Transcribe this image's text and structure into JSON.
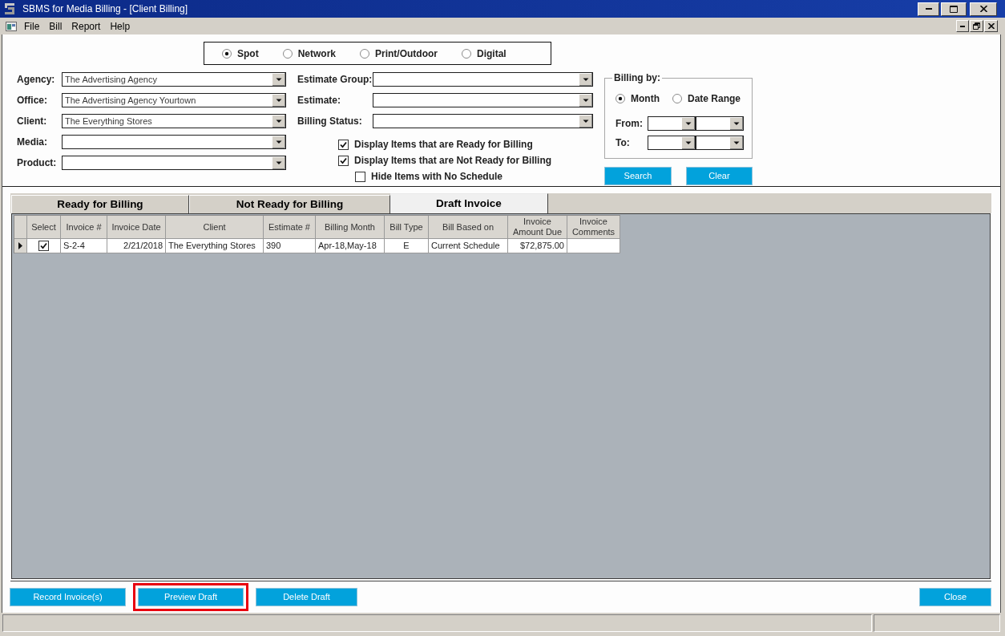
{
  "window": {
    "title": "SBMS for Media Billing - [Client Billing]"
  },
  "menu": [
    "File",
    "Bill",
    "Report",
    "Help"
  ],
  "media_type": [
    {
      "label": "Spot",
      "selected": true
    },
    {
      "label": "Network",
      "selected": false
    },
    {
      "label": "Print/Outdoor",
      "selected": false
    },
    {
      "label": "Digital",
      "selected": false
    }
  ],
  "filters_left": [
    {
      "label": "Agency:",
      "value": "The Advertising Agency"
    },
    {
      "label": "Office:",
      "value": "The Advertising Agency Yourtown"
    },
    {
      "label": "Client:",
      "value": "The Everything Stores"
    },
    {
      "label": "Media:"
    },
    {
      "label": "Product:"
    }
  ],
  "filters_right": [
    {
      "label": "Estimate Group:"
    },
    {
      "label": "Estimate:"
    },
    {
      "label": "Billing Status:"
    }
  ],
  "display_options": [
    {
      "label": "Display Items that are Ready for Billing",
      "checked": true
    },
    {
      "label": "Display Items that are Not Ready for Billing",
      "checked": true,
      "children": [
        {
          "label": "Hide Items with No Schedule",
          "checked": false
        }
      ]
    }
  ],
  "billing_by": {
    "title": "Billing by:",
    "modes": [
      {
        "label": "Month",
        "selected": true
      },
      {
        "label": "Date Range",
        "selected": false
      }
    ],
    "range_fields": [
      {
        "label": "From:"
      },
      {
        "label": "To:"
      }
    ]
  },
  "search_actions": [
    "Search",
    "Clear"
  ],
  "tabs": [
    {
      "label": "Ready for Billing",
      "selected": false
    },
    {
      "label": "Not Ready for Billing",
      "selected": false
    },
    {
      "label": "Draft Invoice",
      "selected": true
    }
  ],
  "table": {
    "columns": [
      {
        "label": "Select",
        "kind": "check"
      },
      {
        "label": "Invoice #",
        "kind": "text"
      },
      {
        "label": "Invoice Date",
        "kind": "number"
      },
      {
        "label": "Client",
        "kind": "text"
      },
      {
        "label": "Estimate #",
        "kind": "text"
      },
      {
        "label": "Billing Month",
        "kind": "text"
      },
      {
        "label": "Bill Type",
        "kind": "code"
      },
      {
        "label": "Bill Based on",
        "kind": "text"
      },
      {
        "label": "Invoice Amount Due",
        "kind": "number"
      },
      {
        "label": "Invoice Comments",
        "kind": "text"
      }
    ],
    "rows": [
      {
        "current": true,
        "cells": [
          {
            "checked": true
          },
          "S-2-4",
          "2/21/2018",
          "The Everything Stores",
          "390",
          "Apr-18,May-18",
          "E",
          "Current Schedule",
          "$72,875.00"
        ]
      }
    ]
  },
  "bottom_actions": [
    {
      "label": "Record Invoice(s)",
      "highlighted": false
    },
    {
      "label": "Preview Draft",
      "highlighted": true
    },
    {
      "label": "Delete Draft",
      "highlighted": false
    }
  ],
  "close_button": {
    "label": "Close"
  }
}
